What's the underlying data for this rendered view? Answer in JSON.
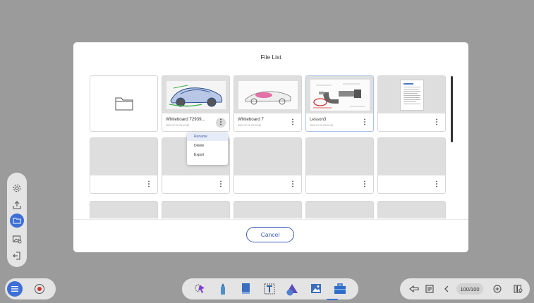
{
  "dialog": {
    "title": "File List",
    "cancel_label": "Cancel"
  },
  "files": [
    {
      "type": "folder"
    },
    {
      "type": "file",
      "name": "Whiteboard 72939...",
      "date": "2020.07.20 20:09:48",
      "thumb": "car-sketch"
    },
    {
      "type": "file",
      "name": "Whiteboard 7",
      "date": "2020.07.20 20:09:46",
      "thumb": "car-drawing"
    },
    {
      "type": "file",
      "name": "Lesson3",
      "date": "2020.07.20 20:09:45",
      "thumb": "micrometer-diagram"
    },
    {
      "type": "file",
      "name": "",
      "date": "",
      "thumb": "document"
    }
  ],
  "context_menu": {
    "items": [
      "Rename",
      "Delete",
      "Export"
    ],
    "highlighted": "Rename"
  },
  "sidebar": {
    "items": [
      "gear-icon",
      "upload-icon",
      "folder-icon",
      "image-icon",
      "exit-icon"
    ],
    "active": "folder-icon"
  },
  "toolbar": {
    "tools": [
      "lasso-tool",
      "pen-tool",
      "eraser-tool",
      "text-tool",
      "shape-tool",
      "insert-image-tool",
      "toolbox-tool"
    ],
    "active": "insert-image-tool"
  },
  "navigation": {
    "page_counter": "100/100"
  },
  "colors": {
    "accent": "#3d6fd6",
    "cancel_border": "#3f5cb8",
    "background": "#9b9b9b"
  }
}
